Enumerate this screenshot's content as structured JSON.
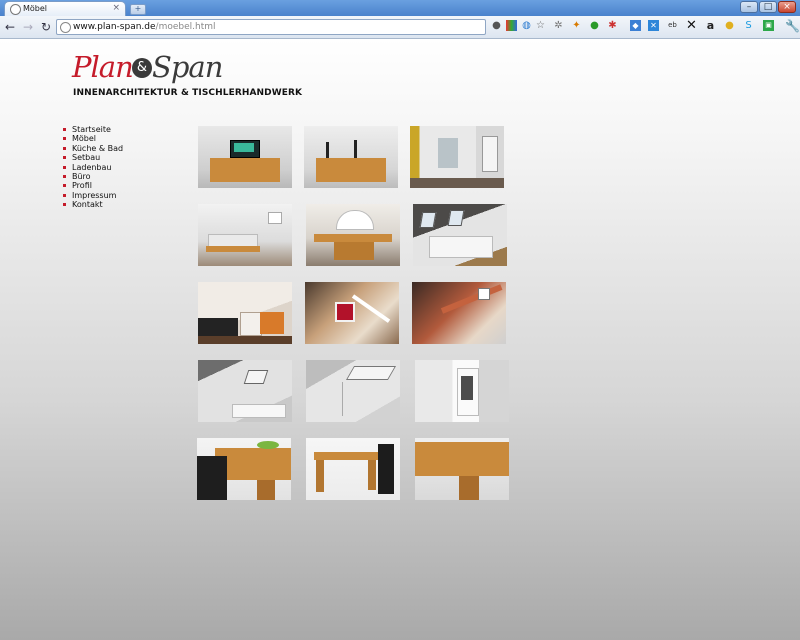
{
  "browser": {
    "tab_title": "Möbel",
    "tab_close": "×",
    "new_tab": "+",
    "url_host": "www.plan-span.de",
    "url_path": "/moebel.html",
    "window_controls": [
      "–",
      "□",
      "×"
    ]
  },
  "header": {
    "logo_plan": "Plan",
    "logo_amp": "&",
    "logo_span": "Span",
    "tagline": "INNENARCHITEKTUR & TISCHLERHANDWERK"
  },
  "nav": {
    "items": [
      "Startseite",
      "Möbel",
      "Küche & Bad",
      "Setbau",
      "Ladenbau",
      "Büro",
      "Profil",
      "Impressum",
      "Kontakt"
    ]
  },
  "colors": {
    "brand_red": "#c51b2a",
    "brand_dark": "#3b3b3b"
  },
  "gallery": {
    "rows": 5,
    "columns": 3,
    "subjects": [
      "sideboard-with-tv",
      "sideboard-with-vases",
      "wardrobe-room",
      "attic-living-room",
      "dining-table-loft",
      "attic-window-cabinet",
      "attic-shelving",
      "staircase-room",
      "staircase-landing",
      "attic-bedroom",
      "attic-storage",
      "built-in-wardrobe",
      "wooden-table-fruit-bowl",
      "wooden-table-chairs",
      "wooden-table-detail"
    ]
  }
}
